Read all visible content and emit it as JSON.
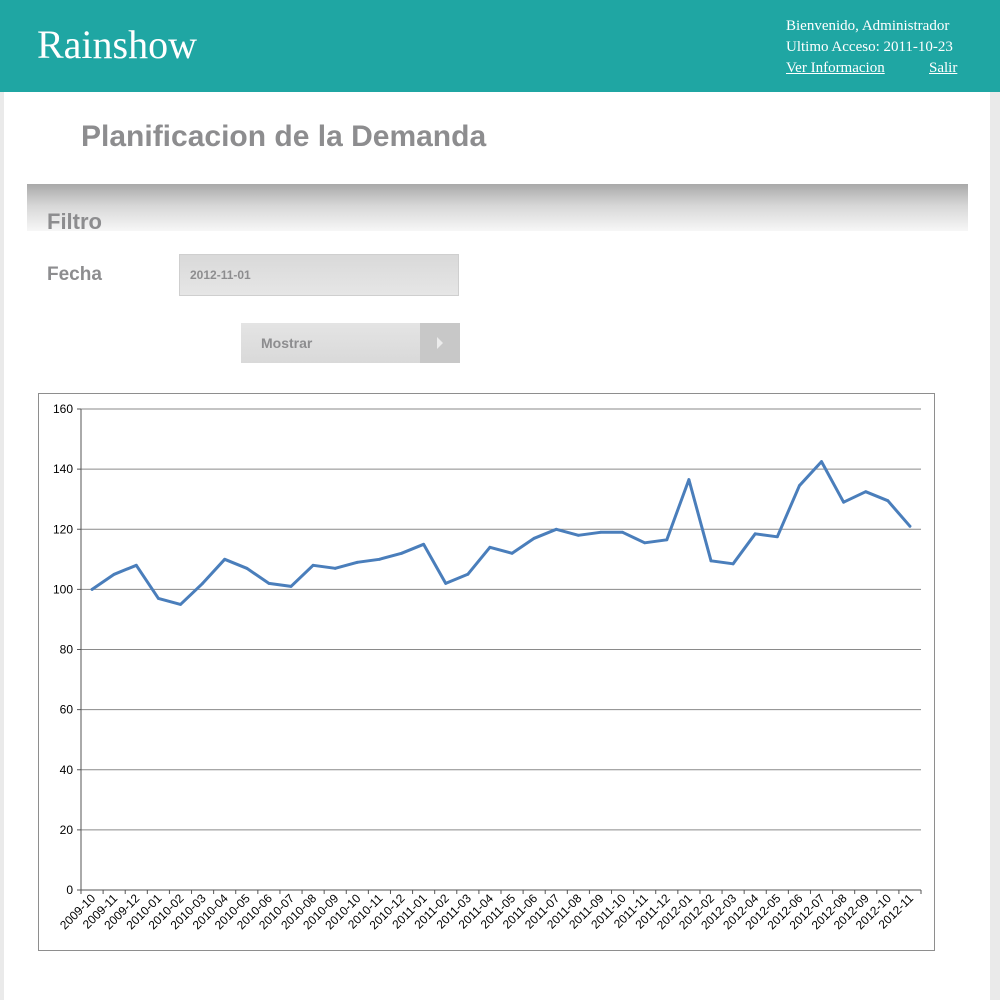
{
  "header": {
    "brand": "Rainshow",
    "welcome": "Bienvenido, Administrador",
    "last_access": "Ultimo Acceso: 2011-10-23",
    "info_link": "Ver Informacion",
    "logout_link": "Salir"
  },
  "page": {
    "title": "Planificacion de la Demanda"
  },
  "filter": {
    "title": "Filtro",
    "date_label": "Fecha",
    "date_value": "2012-11-01",
    "submit_label": "Mostrar"
  },
  "colors": {
    "header_bg": "#1fa6a3",
    "line": "#4a7ebb",
    "label_gray": "#8d8d8f"
  },
  "chart_data": {
    "type": "line",
    "ylim": [
      0,
      160
    ],
    "yticks": [
      0,
      20,
      40,
      60,
      80,
      100,
      120,
      140,
      160
    ],
    "grid": true,
    "categories": [
      "2009-10",
      "2009-11",
      "2009-12",
      "2010-01",
      "2010-02",
      "2010-03",
      "2010-04",
      "2010-05",
      "2010-06",
      "2010-07",
      "2010-08",
      "2010-09",
      "2010-10",
      "2010-11",
      "2010-12",
      "2011-01",
      "2011-02",
      "2011-03",
      "2011-04",
      "2011-05",
      "2011-06",
      "2011-07",
      "2011-08",
      "2011-09",
      "2011-10",
      "2011-11",
      "2011-12",
      "2012-01",
      "2012-02",
      "2012-03",
      "2012-04",
      "2012-05",
      "2012-06",
      "2012-07",
      "2012-08",
      "2012-09",
      "2012-10",
      "2012-11"
    ],
    "values": [
      100,
      105,
      108,
      97,
      95,
      102,
      110,
      107,
      102,
      101,
      108,
      107,
      109,
      110,
      112,
      115,
      102,
      105,
      114,
      112,
      117,
      120,
      118,
      119,
      119,
      115.5,
      116.5,
      136.5,
      109.5,
      108.5,
      118.5,
      117.5,
      134.5,
      142.5,
      129,
      132.5,
      129.5,
      121
    ]
  }
}
